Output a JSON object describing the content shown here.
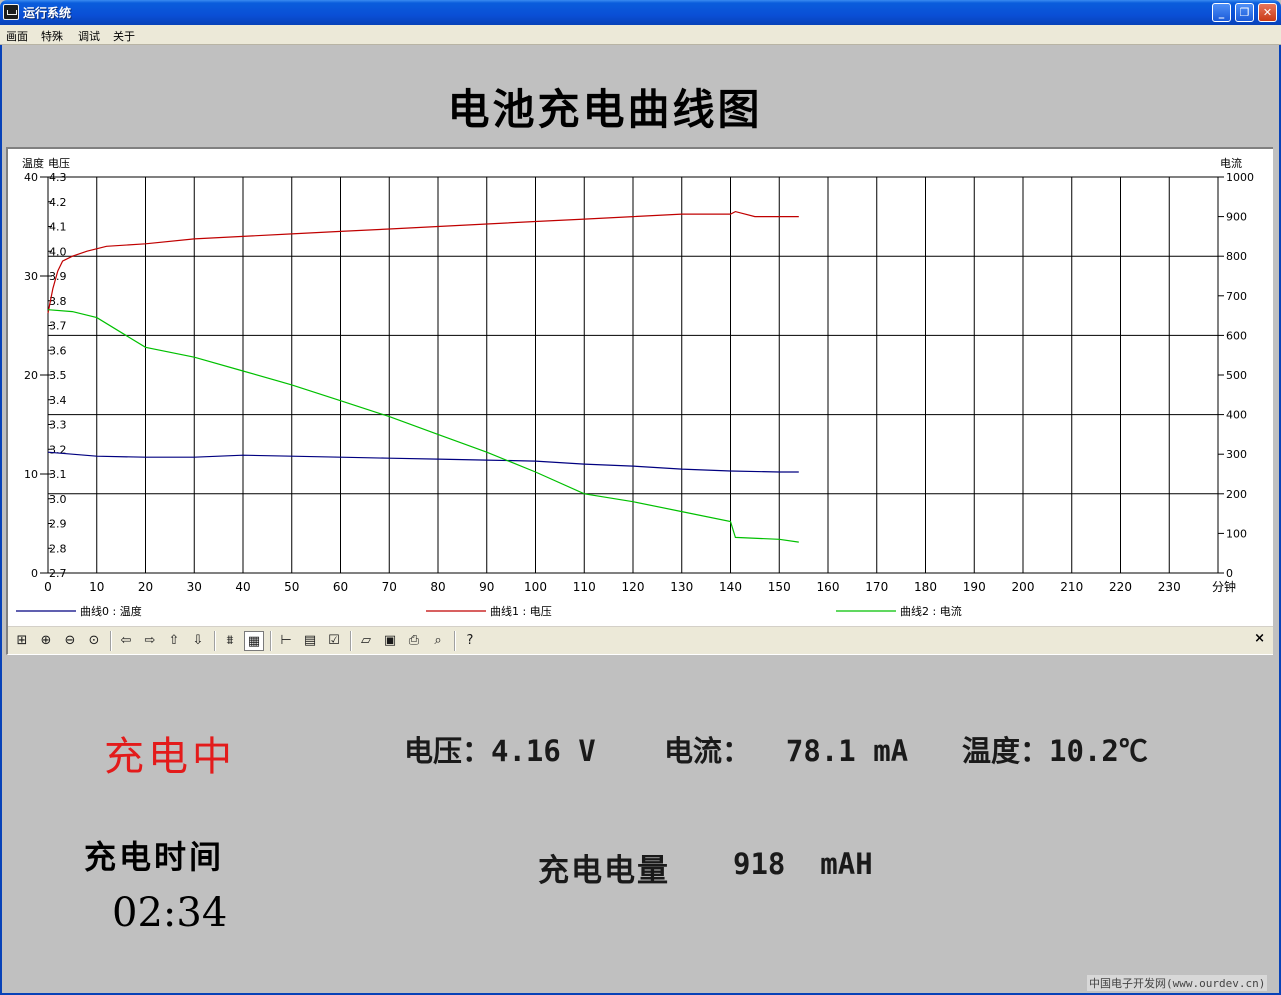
{
  "window": {
    "title": "运行系统",
    "controls": {
      "minimize": "_",
      "maximize": "❐",
      "close": "✕"
    }
  },
  "menu": [
    "画面",
    "特殊",
    "调试",
    "关于"
  ],
  "page_title": "电池充电曲线图",
  "chart_data": {
    "type": "line",
    "x_label": "分钟",
    "x_range": [
      0,
      240
    ],
    "x_ticks": [
      "0",
      "10",
      "20",
      "30",
      "40",
      "50",
      "60",
      "70",
      "80",
      "90",
      "100",
      "110",
      "120",
      "130",
      "140",
      "150",
      "160",
      "170",
      "180",
      "190",
      "200",
      "210",
      "220",
      "230"
    ],
    "left_axis_1": {
      "label": "温度",
      "range": [
        0,
        40
      ],
      "ticks": [
        "0",
        "10",
        "20",
        "30",
        "40"
      ]
    },
    "left_axis_2": {
      "label": "电压",
      "range": [
        2.7,
        4.3
      ],
      "ticks": [
        "2.7",
        "2.8",
        "2.9",
        "3.0",
        "3.1",
        "3.2",
        "3.3",
        "3.4",
        "3.5",
        "3.6",
        "3.7",
        "3.8",
        "3.9",
        "4.0",
        "4.1",
        "4.2",
        "4.3"
      ]
    },
    "right_axis": {
      "label": "电流",
      "range": [
        0,
        1000
      ],
      "ticks": [
        "0",
        "100",
        "200",
        "300",
        "400",
        "500",
        "600",
        "700",
        "800",
        "900",
        "1000"
      ]
    },
    "grid": true,
    "legend_position": "bottom",
    "series": [
      {
        "name": "曲线0 : 温度",
        "axis": "temperature",
        "color": "#000080",
        "x": [
          0,
          5,
          10,
          20,
          30,
          40,
          50,
          60,
          70,
          80,
          90,
          100,
          110,
          120,
          130,
          140,
          150,
          154
        ],
        "y": [
          12.2,
          12.0,
          11.8,
          11.7,
          11.7,
          11.9,
          11.8,
          11.7,
          11.6,
          11.5,
          11.4,
          11.3,
          11.0,
          10.8,
          10.5,
          10.3,
          10.2,
          10.2
        ]
      },
      {
        "name": "曲线1 : 电压",
        "axis": "voltage",
        "color": "#c00000",
        "x": [
          0,
          1,
          2,
          3,
          5,
          8,
          12,
          20,
          30,
          40,
          50,
          60,
          70,
          80,
          90,
          100,
          110,
          120,
          130,
          140,
          141,
          145,
          150,
          154
        ],
        "y": [
          3.75,
          3.85,
          3.92,
          3.96,
          3.98,
          4.0,
          4.02,
          4.03,
          4.05,
          4.06,
          4.07,
          4.08,
          4.09,
          4.1,
          4.11,
          4.12,
          4.13,
          4.14,
          4.15,
          4.15,
          4.16,
          4.14,
          4.14,
          4.14
        ]
      },
      {
        "name": "曲线2 : 电流",
        "axis": "current",
        "color": "#00c000",
        "x": [
          0,
          5,
          10,
          20,
          30,
          40,
          50,
          60,
          70,
          80,
          90,
          100,
          110,
          120,
          130,
          140,
          141,
          150,
          154
        ],
        "y": [
          665,
          660,
          645,
          570,
          545,
          510,
          475,
          435,
          395,
          350,
          305,
          255,
          200,
          180,
          155,
          130,
          90,
          85,
          78
        ]
      }
    ]
  },
  "toolbar_icons": [
    "zoom-fit-icon",
    "zoom-in-icon",
    "zoom-out-icon",
    "zoom-reset-icon",
    "pan-left-icon",
    "pan-right-icon",
    "pan-up-icon",
    "pan-down-icon",
    "chart-mode-icon",
    "grid-icon",
    "cursor-icon",
    "data-table-icon",
    "properties-icon",
    "open-icon",
    "save-icon",
    "print-icon",
    "preview-icon",
    "help-icon"
  ],
  "status": {
    "charging": "充电中",
    "voltage_text": "电压：4.16 V",
    "current_text": "电流：  78.1 mA",
    "temperature_text": "温度：10.2℃",
    "charge_time_label": "充电时间",
    "charge_time": "02:34",
    "capacity_label": "充电电量",
    "capacity_value": "918  mAH"
  },
  "watermark": "中国电子开发网(www.ourdev.cn)"
}
